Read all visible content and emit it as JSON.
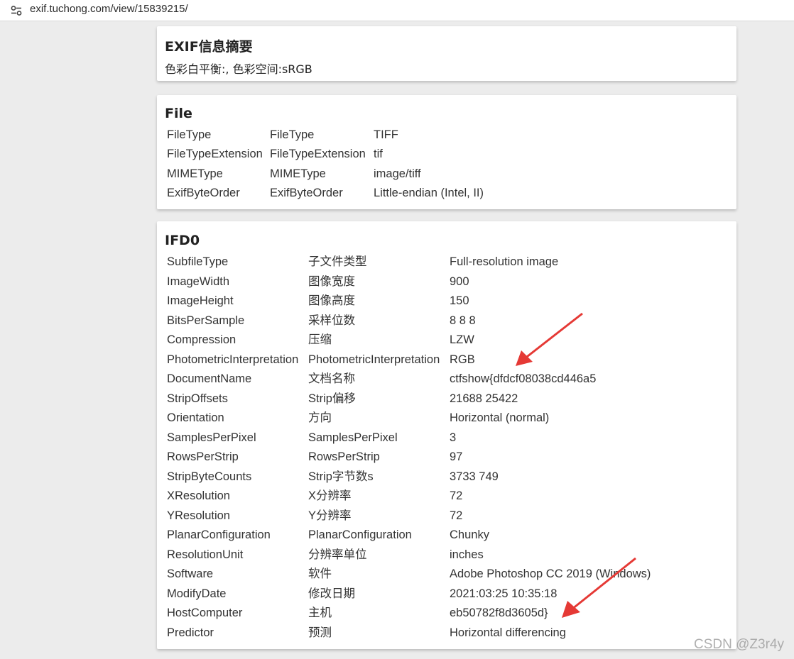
{
  "browser": {
    "url": "exif.tuchong.com/view/15839215/",
    "site_icon": "tune-icon"
  },
  "summary": {
    "title": "EXIF信息摘要",
    "text": "色彩白平衡:, 色彩空间:sRGB"
  },
  "file": {
    "title": "File",
    "rows": [
      {
        "tag": "FileType",
        "label": "FileType",
        "value": "TIFF"
      },
      {
        "tag": "FileTypeExtension",
        "label": "FileTypeExtension",
        "value": "tif"
      },
      {
        "tag": "MIMEType",
        "label": "MIMEType",
        "value": "image/tiff"
      },
      {
        "tag": "ExifByteOrder",
        "label": "ExifByteOrder",
        "value": "Little-endian (Intel, II)"
      }
    ]
  },
  "ifd0": {
    "title": "IFD0",
    "rows": [
      {
        "tag": "SubfileType",
        "label": "子文件类型",
        "value": "Full-resolution image"
      },
      {
        "tag": "ImageWidth",
        "label": "图像宽度",
        "value": "900"
      },
      {
        "tag": "ImageHeight",
        "label": "图像高度",
        "value": "150"
      },
      {
        "tag": "BitsPerSample",
        "label": "采样位数",
        "value": "8 8 8"
      },
      {
        "tag": "Compression",
        "label": "压缩",
        "value": "LZW"
      },
      {
        "tag": "PhotometricInterpretation",
        "label": "PhotometricInterpretation",
        "value": "RGB"
      },
      {
        "tag": "DocumentName",
        "label": "文档名称",
        "value": "ctfshow{dfdcf08038cd446a5"
      },
      {
        "tag": "StripOffsets",
        "label": "Strip偏移",
        "value": "21688 25422"
      },
      {
        "tag": "Orientation",
        "label": "方向",
        "value": "Horizontal (normal)"
      },
      {
        "tag": "SamplesPerPixel",
        "label": "SamplesPerPixel",
        "value": "3"
      },
      {
        "tag": "RowsPerStrip",
        "label": "RowsPerStrip",
        "value": "97"
      },
      {
        "tag": "StripByteCounts",
        "label": "Strip字节数s",
        "value": "3733 749"
      },
      {
        "tag": "XResolution",
        "label": "X分辨率",
        "value": "72"
      },
      {
        "tag": "YResolution",
        "label": "Y分辨率",
        "value": "72"
      },
      {
        "tag": "PlanarConfiguration",
        "label": "PlanarConfiguration",
        "value": "Chunky"
      },
      {
        "tag": "ResolutionUnit",
        "label": "分辨率单位",
        "value": "inches"
      },
      {
        "tag": "Software",
        "label": "软件",
        "value": "Adobe Photoshop CC 2019 (Windows)"
      },
      {
        "tag": "ModifyDate",
        "label": "修改日期",
        "value": "2021:03:25 10:35:18"
      },
      {
        "tag": "HostComputer",
        "label": "主机",
        "value": "eb50782f8d3605d}"
      },
      {
        "tag": "Predictor",
        "label": "预测",
        "value": "Horizontal differencing"
      }
    ]
  },
  "annotations": {
    "arrow_color": "#e53935"
  },
  "watermark": "CSDN @Z3r4y"
}
